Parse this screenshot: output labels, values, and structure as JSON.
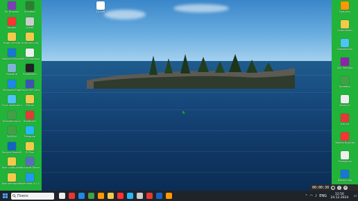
{
  "colors": {
    "side_panel": "#22b33b",
    "taskbar": "#1f232a",
    "water": "#16467a",
    "sky": "#6aaee0"
  },
  "desktop": {
    "icons": [
      {
        "label": "Tor Browser",
        "color": "#7a3fb5"
      },
      {
        "label": "Shinebar",
        "color": "#2e7d32"
      },
      {
        "label": "Yandex",
        "color": "#ff3333"
      },
      {
        "label": "Lidetit",
        "color": "#cccccc"
      },
      {
        "label": "Коды гитона",
        "color": "#f2c94c"
      },
      {
        "label": "autorunrz.zip",
        "color": "#f2c94c"
      },
      {
        "label": "Yandex5 Музыка",
        "color": "#1976d2"
      },
      {
        "label": "ЛКОЛ Приложение",
        "color": "#eeeeee"
      },
      {
        "label": "Корзина",
        "color": "#7fb3d5"
      },
      {
        "label": "ProtoMaker",
        "color": "#222222"
      },
      {
        "label": "Microsoft Edge",
        "color": "#1e88e5"
      },
      {
        "label": "Oracle VM VirtualBox",
        "color": "#3f51b5"
      },
      {
        "label": "Этот компьютер",
        "color": "#4fc3f7"
      },
      {
        "label": "Tribute",
        "color": "#f2c94c"
      },
      {
        "label": "Безопасность",
        "color": "#43a047"
      },
      {
        "label": "Bandicam",
        "color": "#e53935"
      },
      {
        "label": "ЗАБРАН",
        "color": "#43a047"
      },
      {
        "label": "Telegram",
        "color": "#29b6f6"
      },
      {
        "label": "Запуск PowerShell",
        "color": "#1565c0"
      },
      {
        "label": "PCPlus",
        "color": "#f2c94c"
      },
      {
        "label": "Мое сообщение",
        "color": "#f2c94c"
      },
      {
        "label": "Microsoft Teams",
        "color": "#5c6bc0"
      },
      {
        "label": "Мои материалы",
        "color": "#f2c94c"
      },
      {
        "label": "OpenShot 4.1.1",
        "color": "#2196f3"
      }
    ],
    "right_icons": [
      {
        "label": "Браузер",
        "color": "#ff9800"
      },
      {
        "label": "Commander",
        "color": "#f2c94c"
      },
      {
        "label": "Компьютер",
        "color": "#4fc3f7"
      },
      {
        "label": "Xinj Settings",
        "color": "#8e24aa"
      },
      {
        "label": "Хромбук",
        "color": "#43a047"
      },
      {
        "label": "Аккаунт",
        "color": "#eeeeee"
      },
      {
        "label": "IDA 64",
        "color": "#e53935"
      },
      {
        "label": "Yandex Браузер",
        "color": "#ff3333"
      },
      {
        "label": "Телефоны",
        "color": "#eeeeee"
      },
      {
        "label": "Диспетчер",
        "color": "#1976d2"
      }
    ],
    "center_file_label": "1a.dpff"
  },
  "taskbar": {
    "search_placeholder": "Поиск",
    "apps": [
      "#eeeeee",
      "#e53935",
      "#1e88e5",
      "#43a047",
      "#ff9800",
      "#f2c94c",
      "#ff3333",
      "#29b6f6",
      "#cccccc",
      "#e53935",
      "#1565c0",
      "#ff9800"
    ],
    "tray": {
      "lang": "ENG",
      "time": "12:50",
      "date": "24.12.2024"
    }
  },
  "recorder": {
    "elapsed": "00:00:30"
  }
}
